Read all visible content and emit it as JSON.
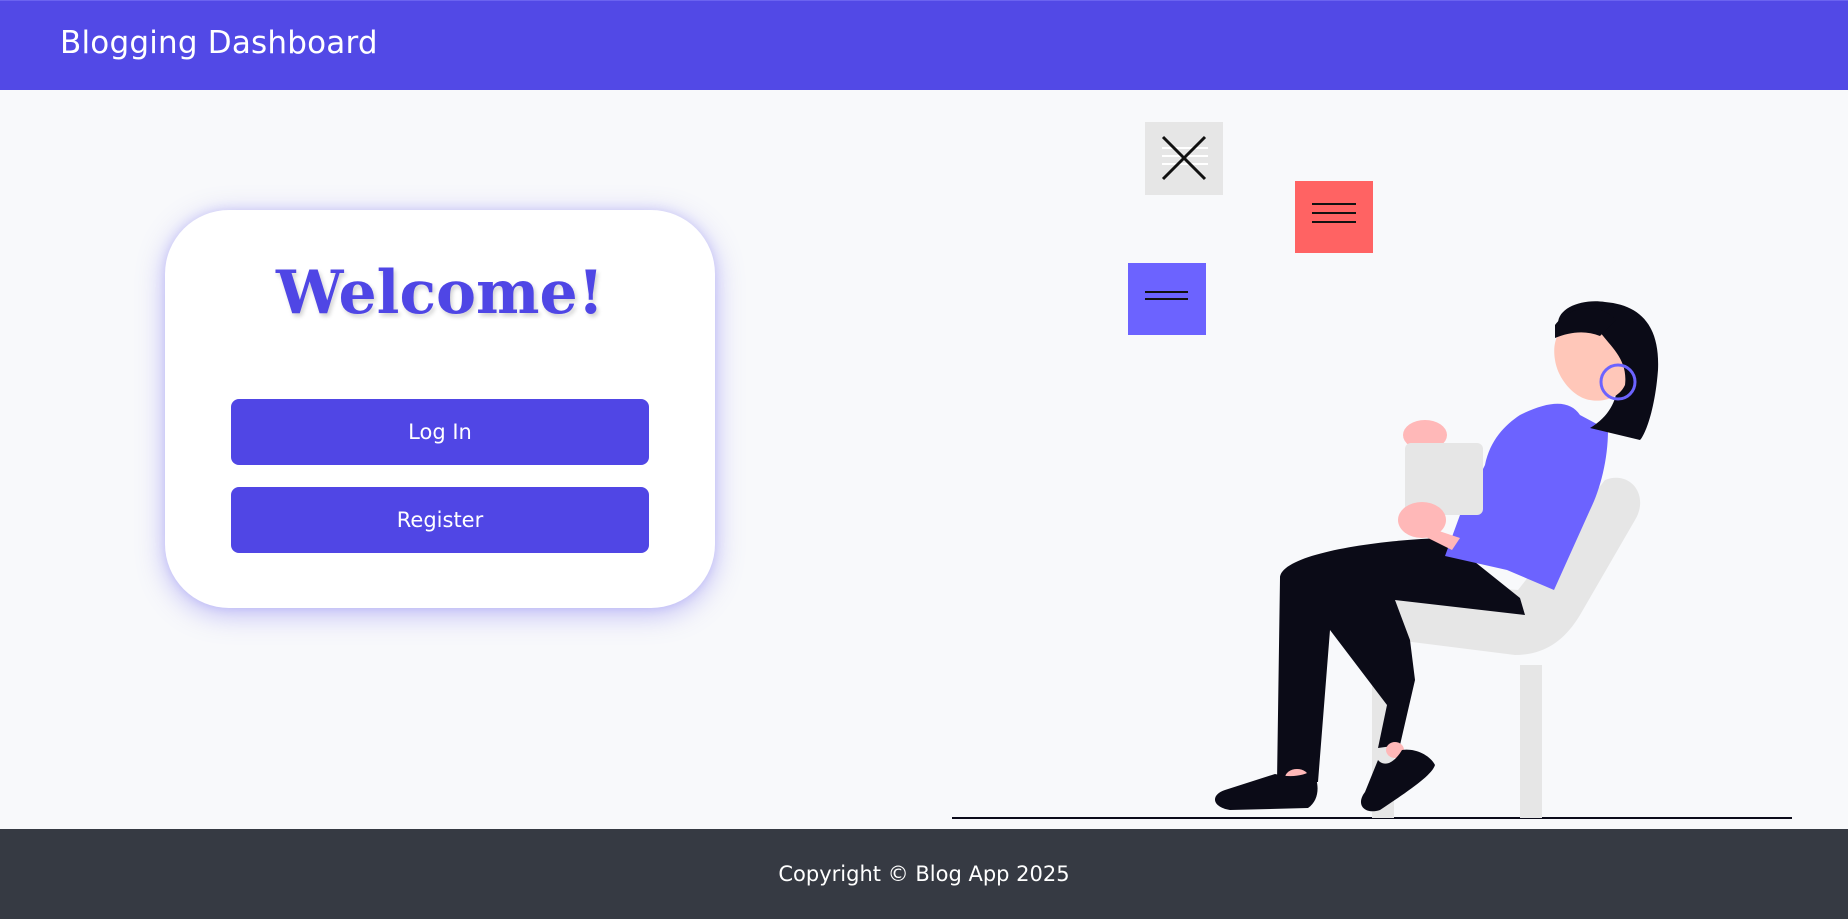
{
  "header": {
    "title": "Blogging Dashboard"
  },
  "welcome_card": {
    "heading": "Welcome!",
    "login_label": "Log In",
    "register_label": "Register"
  },
  "illustration": {
    "icons": [
      "close-icon",
      "menu-icon",
      "menu-icon"
    ]
  },
  "footer": {
    "copyright": "Copyright © Blog App 2025"
  },
  "colors": {
    "primary": "#5046e5",
    "illustration_purple": "#6c63ff",
    "illustration_red": "#ff6363",
    "footer_bg": "#363a43",
    "page_bg": "#f8f9fb"
  }
}
